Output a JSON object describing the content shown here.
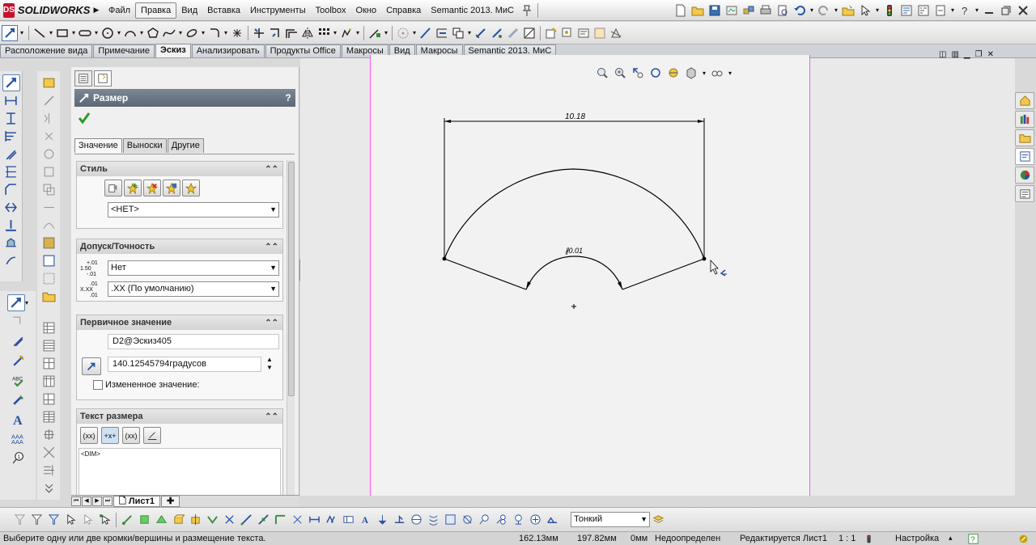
{
  "app": {
    "logo_mark": "DS",
    "brand": "SOLIDWORKS"
  },
  "menu": {
    "items": [
      "Файл",
      "Правка",
      "Вид",
      "Вставка",
      "Инструменты",
      "Toolbox",
      "Окно",
      "Справка",
      "Semantic 2013. МиС"
    ],
    "active_index": 1
  },
  "command_tabs": {
    "items": [
      "Расположение вида",
      "Примечание",
      "Эскиз",
      "Анализировать",
      "Продукты Office",
      "Макросы",
      "Вид",
      "Макросы",
      "Semantic 2013. МиС"
    ],
    "active_index": 2
  },
  "property_manager": {
    "title": "Размер",
    "help": "?",
    "subtabs": [
      "Значение",
      "Выноски",
      "Другие"
    ],
    "style_group": {
      "title": "Стиль",
      "dropdown_value": "<НЕТ>"
    },
    "tolerance_group": {
      "title": "Допуск/Точность",
      "tolerance_icon_text": "1.50",
      "tolerance_value": "Нет",
      "precision_icon_text": "X.XX",
      "precision_value": ".XX (По умолчанию)"
    },
    "primary_group": {
      "title": "Первичное значение",
      "name": "D2@Эскиз405",
      "value": "140.12545794градусов",
      "override_label": "Измененное значение:"
    },
    "text_group": {
      "title": "Текст размера",
      "buttons": [
        "(xx)",
        "+x+",
        "(xx)"
      ],
      "text": "<DIM>"
    }
  },
  "sheet_tabs": {
    "active": "Лист1"
  },
  "drawing": {
    "dim_top": "10.18",
    "dim_inner": "∦0.01"
  },
  "bottom_toolbar": {
    "line_thickness": "Тонкий"
  },
  "status": {
    "message": "Выберите одну или две кромки/вершины и размещение текста.",
    "x": "162.13мм",
    "y": "197.82мм",
    "z": "0мм",
    "state": "Недоопределен",
    "editing": "Редактируется Лист1",
    "scale": "1 : 1",
    "settings": "Настройка"
  },
  "colors": {
    "sheet_border": "#ff55ff",
    "sketch_line": "#000000",
    "pm_header": "#66717f"
  }
}
